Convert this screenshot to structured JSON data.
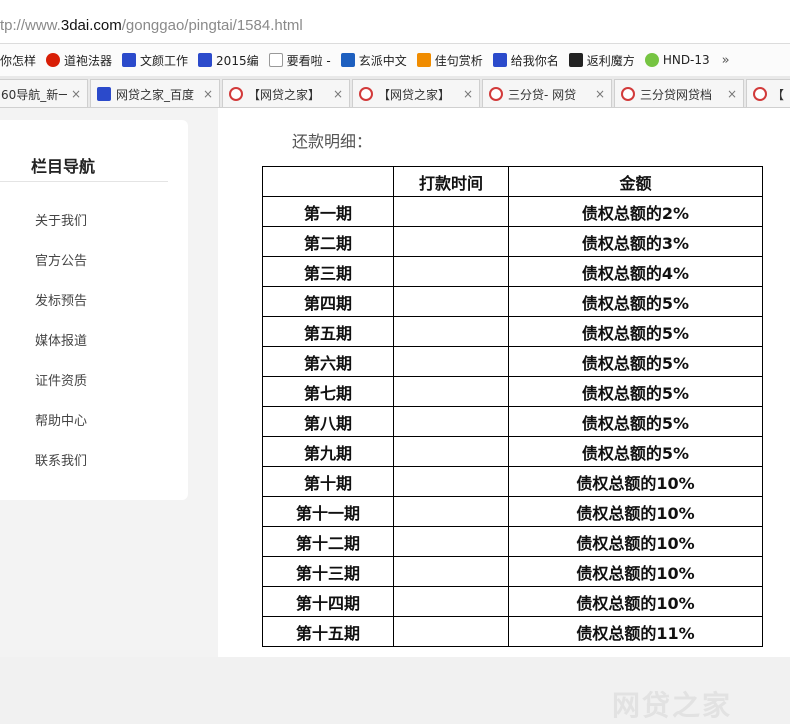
{
  "address_bar": {
    "prefix": "tp://www.",
    "host": "3dai.com",
    "path": "/gonggao/pingtai/1584.html"
  },
  "bookmarks": [
    {
      "label": "你怎样",
      "icon": "none"
    },
    {
      "label": "道袍法器",
      "icon": "circle-logo-icon",
      "color": "#d81e06"
    },
    {
      "label": "文颜工作",
      "icon": "paw-icon",
      "color": "#2b4acb"
    },
    {
      "label": "2015编",
      "icon": "paw-icon",
      "color": "#2b4acb"
    },
    {
      "label": "要看啦 -",
      "icon": "page-icon",
      "color": "#999999"
    },
    {
      "label": "玄派中文",
      "icon": "c-logo-icon",
      "color": "#1d5fbf"
    },
    {
      "label": "佳句赏析",
      "icon": "ju-logo-icon",
      "color": "#f08c00"
    },
    {
      "label": "给我你名",
      "icon": "paw-icon",
      "color": "#2b4acb"
    },
    {
      "label": "返利魔方",
      "icon": "cube-icon",
      "color": "#222222"
    },
    {
      "label": "HND-13",
      "icon": "green-dot-icon",
      "color": "#76c442"
    }
  ],
  "bookmarks_more": "»",
  "tabs": [
    {
      "label": "60导航_新一",
      "icon": "none"
    },
    {
      "label": "网贷之家_百度",
      "icon": "paw-icon"
    },
    {
      "label": "【网贷之家】",
      "icon": "wdzj-logo-icon"
    },
    {
      "label": "【网贷之家】",
      "icon": "wdzj-logo-icon"
    },
    {
      "label": "三分贷- 网贷",
      "icon": "wdzj-logo-icon"
    },
    {
      "label": "三分贷网贷档",
      "icon": "wdzj-logo-icon"
    },
    {
      "label": "【",
      "icon": "wdzj-logo-icon"
    }
  ],
  "sidebar": {
    "title": "栏目导航",
    "items": [
      "关于我们",
      "官方公告",
      "发标预告",
      "媒体报道",
      "证件资质",
      "帮助中心",
      "联系我们"
    ]
  },
  "content": {
    "heading": "还款明细：",
    "table": {
      "headers": [
        "",
        "打款时间",
        "金额"
      ],
      "rows": [
        [
          "第一期",
          "",
          "债权总额的2%"
        ],
        [
          "第二期",
          "",
          "债权总额的3%"
        ],
        [
          "第三期",
          "",
          "债权总额的4%"
        ],
        [
          "第四期",
          "",
          "债权总额的5%"
        ],
        [
          "第五期",
          "",
          "债权总额的5%"
        ],
        [
          "第六期",
          "",
          "债权总额的5%"
        ],
        [
          "第七期",
          "",
          "债权总额的5%"
        ],
        [
          "第八期",
          "",
          "债权总额的5%"
        ],
        [
          "第九期",
          "",
          "债权总额的5%"
        ],
        [
          "第十期",
          "",
          "债权总额的10%"
        ],
        [
          "第十一期",
          "",
          "债权总额的10%"
        ],
        [
          "第十二期",
          "",
          "债权总额的10%"
        ],
        [
          "第十三期",
          "",
          "债权总额的10%"
        ],
        [
          "第十四期",
          "",
          "债权总额的10%"
        ],
        [
          "第十五期",
          "",
          "债权总额的11%"
        ]
      ]
    }
  },
  "watermark": "网贷之家"
}
